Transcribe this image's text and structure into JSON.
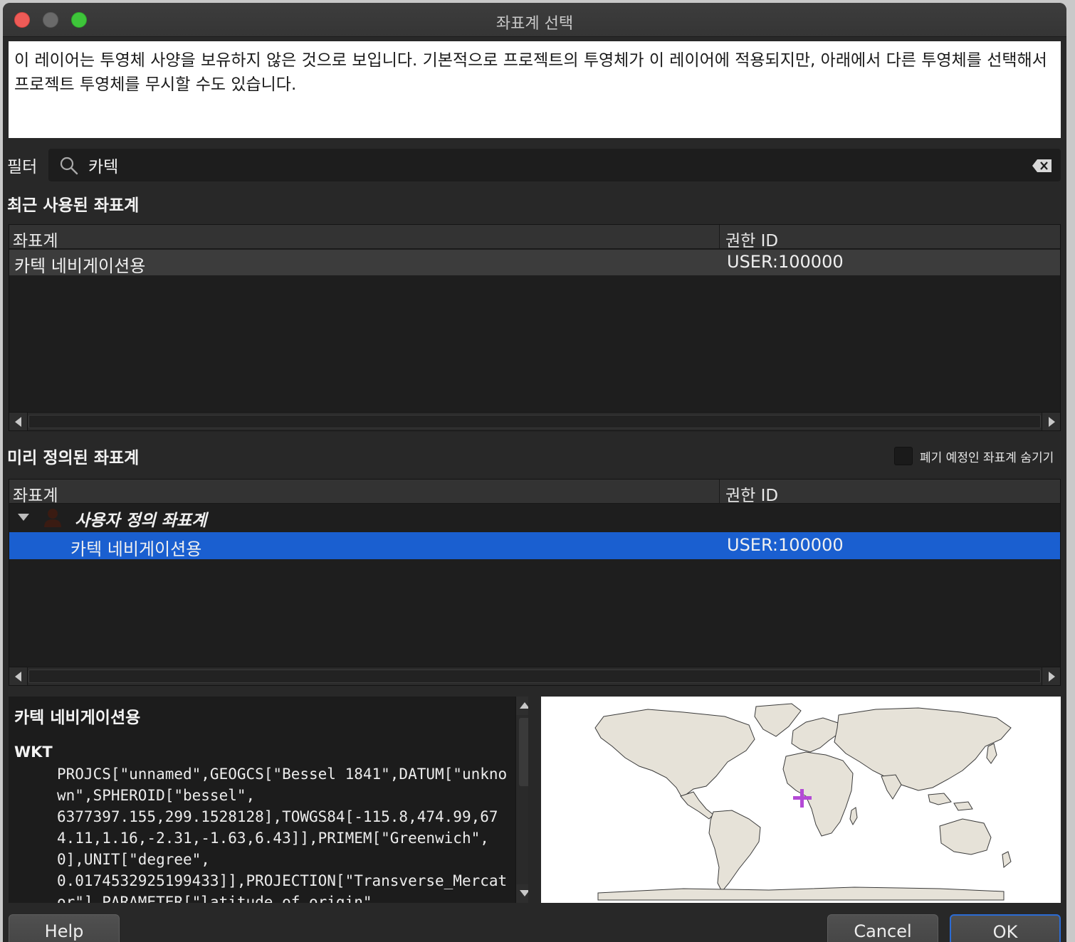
{
  "window": {
    "title": "좌표계 선택"
  },
  "message": "이 레이어는 투영체 사양을 보유하지 않은 것으로 보입니다. 기본적으로 프로젝트의 투영체가 이 레이어에 적용되지만, 아래에서 다른 투영체를 선택해서 프로젝트 투영체를 무시할 수도 있습니다.",
  "filter": {
    "label": "필터",
    "value": "카텍"
  },
  "recent": {
    "title": "최근 사용된 좌표계",
    "columns": [
      "좌표계",
      "권한 ID"
    ],
    "rows": [
      {
        "name": "카텍 네비게이션용",
        "auth_id": "USER:100000"
      }
    ]
  },
  "predefined": {
    "title": "미리 정의된 좌표계",
    "hide_deprecated_label": "폐기 예정인 좌표계 숨기기",
    "hide_deprecated_checked": false,
    "columns": [
      "좌표계",
      "권한 ID"
    ],
    "group": "사용자 정의 좌표계",
    "rows": [
      {
        "name": "카텍 네비게이션용",
        "auth_id": "USER:100000",
        "selected": true
      }
    ]
  },
  "details": {
    "title": "카텍 네비게이션용",
    "wkt_label": "WKT",
    "wkt": "PROJCS[\"unnamed\",GEOGCS[\"Bessel 1841\",DATUM[\"unknown\",SPHEROID[\"bessel\",\n6377397.155,299.1528128],TOWGS84[-115.8,474.99,674.11,1.16,-2.31,-1.63,6.43]],PRIMEM[\"Greenwich\",0],UNIT[\"degree\",\n0.0174532925199433]],PROJECTION[\"Transverse_Mercator\"],PARAMETER[\"latitude_of_origin\","
  },
  "buttons": {
    "help": "Help",
    "cancel": "Cancel",
    "ok": "OK"
  },
  "colors": {
    "selection": "#1a5fd0",
    "accent": "#2b6bd4",
    "marker": "#b44ad6"
  }
}
